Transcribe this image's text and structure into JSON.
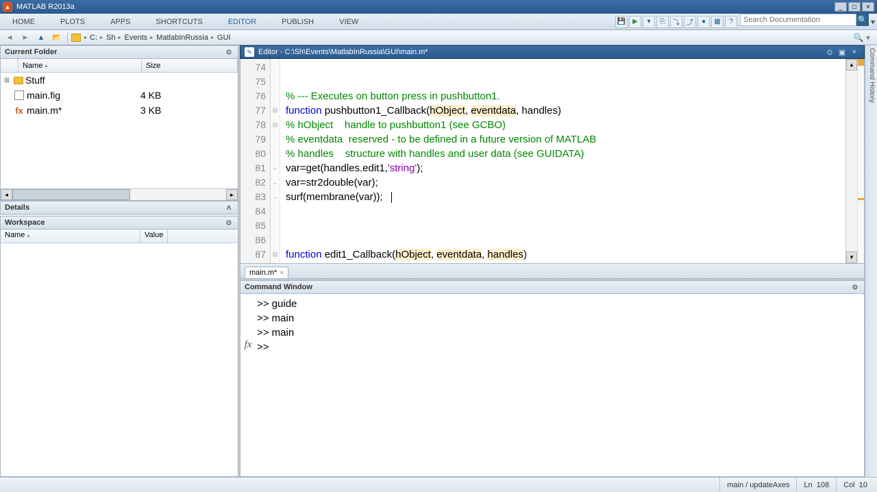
{
  "title": "MATLAB R2013a",
  "tabs": [
    "HOME",
    "PLOTS",
    "APPS",
    "SHORTCUTS",
    "EDITOR",
    "PUBLISH",
    "VIEW"
  ],
  "search_placeholder": "Search Documentation",
  "breadcrumb": [
    "C:",
    "Sh",
    "Events",
    "MatlabInRussia",
    "GUI"
  ],
  "current_folder": {
    "title": "Current Folder",
    "cols": {
      "name": "Name",
      "size": "Size"
    },
    "rows": [
      {
        "expander": "⊞",
        "icon": "folder",
        "name": "Stuff",
        "size": ""
      },
      {
        "expander": "",
        "icon": "fig",
        "name": "main.fig",
        "size": "4 KB"
      },
      {
        "expander": "",
        "icon": "m",
        "name": "main.m*",
        "size": "3 KB"
      }
    ]
  },
  "details": {
    "title": "Details"
  },
  "workspace": {
    "title": "Workspace",
    "cols": {
      "name": "Name",
      "value": "Value"
    }
  },
  "editor": {
    "title": "Editor - C:\\Sh\\Events\\MatlabInRussia\\GUI\\main.m*",
    "tab": "main.m*",
    "lines": [
      {
        "n": 74,
        "fold": "",
        "html": ""
      },
      {
        "n": 75,
        "fold": "",
        "html": ""
      },
      {
        "n": 76,
        "fold": "",
        "html": "<span class='com'>% --- Executes on button press in pushbutton1.</span>"
      },
      {
        "n": 77,
        "fold": "⊟",
        "html": "<span class='kw'>function</span> pushbutton1_Callback(<span class='hl'>hObject</span>, <span class='hl'>eventdata</span>, handles)"
      },
      {
        "n": 78,
        "fold": "⊟",
        "html": "<span class='com'>% hObject    handle to pushbutton1 (see GCBO)</span>"
      },
      {
        "n": 79,
        "fold": "",
        "html": "<span class='com'>% eventdata  reserved - to be defined in a future version of MATLAB</span>"
      },
      {
        "n": 80,
        "fold": "",
        "html": "<span class='com'>% handles    structure with handles and user data (see GUIDATA)</span>"
      },
      {
        "n": 81,
        "fold": "–",
        "html": "var=get(handles.edit1,<span class='str'>'string'</span>);"
      },
      {
        "n": 82,
        "fold": "–",
        "html": "var=str2double(var);"
      },
      {
        "n": 83,
        "fold": "–",
        "html": "surf(membrane(var));<span class='cursor-bar'></span>"
      },
      {
        "n": 84,
        "fold": "",
        "html": ""
      },
      {
        "n": 85,
        "fold": "",
        "html": ""
      },
      {
        "n": 86,
        "fold": "",
        "html": ""
      },
      {
        "n": 87,
        "fold": "⊟",
        "html": "<span class='kw'>function</span> edit1_Callback(<span class='hl'>hObject</span>, <span class='hl'>eventdata</span>, <span class='hl'>handles</span>)"
      }
    ]
  },
  "command_window": {
    "title": "Command Window",
    "lines": [
      ">> guide",
      ">> main",
      ">> main",
      ">> "
    ]
  },
  "status": {
    "fn": "main / updateAxes",
    "ln_label": "Ln",
    "ln": "108",
    "col_label": "Col",
    "col": "10"
  },
  "rightstrip": "Command History"
}
